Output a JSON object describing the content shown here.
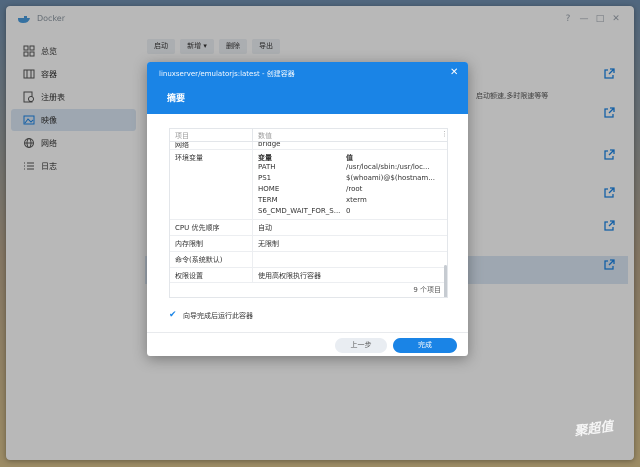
{
  "app": {
    "title": "Docker"
  },
  "sidebar": {
    "items": [
      {
        "label": "总览",
        "icon": "overview-icon",
        "active": false
      },
      {
        "label": "容器",
        "icon": "container-icon",
        "active": false
      },
      {
        "label": "注册表",
        "icon": "registry-icon",
        "active": false
      },
      {
        "label": "映像",
        "icon": "image-icon",
        "active": true
      },
      {
        "label": "网络",
        "icon": "network-icon",
        "active": false
      },
      {
        "label": "日志",
        "icon": "log-icon",
        "active": false
      }
    ]
  },
  "toolbar": {
    "start": "启动",
    "add": "新增",
    "delete": "删除",
    "export": "导出"
  },
  "background": {
    "partial_text": "启动额速,多时限速等等"
  },
  "dialog": {
    "title": "linuxserver/emulatorjs:latest - 创建容器",
    "step": "摘要",
    "columns": {
      "item": "项目",
      "value": "数值"
    },
    "partial_row": "网络",
    "partial_value": "bridge",
    "env": {
      "label": "环境变量",
      "var_header": "变量",
      "val_header": "值",
      "rows": [
        {
          "var": "PATH",
          "val": "/usr/local/sbin:/usr/loc..."
        },
        {
          "var": "PS1",
          "val": "$(whoami)@$(hostnam..."
        },
        {
          "var": "HOME",
          "val": "/root"
        },
        {
          "var": "TERM",
          "val": "xterm"
        },
        {
          "var": "S6_CMD_WAIT_FOR_S...",
          "val": "0"
        }
      ]
    },
    "rows": [
      {
        "item": "CPU 优先顺序",
        "value": "自动"
      },
      {
        "item": "内存限制",
        "value": "无限制"
      },
      {
        "item": "命令(系统默认)",
        "value": ""
      },
      {
        "item": "权限设置",
        "value": "使用高权限执行容器"
      }
    ],
    "count": "9 个项目",
    "run_after": "向导完成后运行此容器",
    "prev": "上一步",
    "done": "完成"
  },
  "watermark": "聚超值",
  "colors": {
    "accent": "#1a84e6",
    "selected": "#dce8f6"
  }
}
